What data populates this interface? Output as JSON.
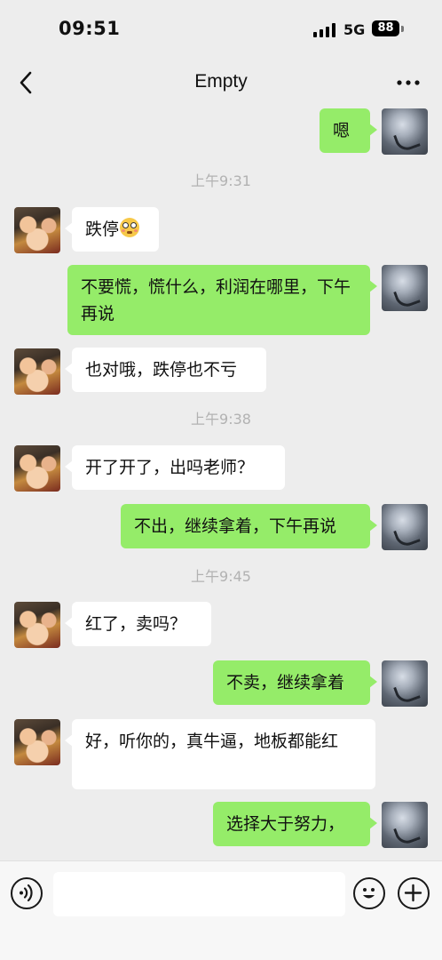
{
  "status_bar": {
    "time": "09:51",
    "network": "5G",
    "battery": "88"
  },
  "header": {
    "title": "Empty"
  },
  "messages": [
    {
      "sender": "self",
      "text": "嗯"
    },
    {
      "type": "time",
      "text": "上午9:31"
    },
    {
      "sender": "other",
      "text": "跌停"
    },
    {
      "sender": "self",
      "text": "不要慌，慌什么，利润在哪里，下午再说"
    },
    {
      "sender": "other",
      "text": "也对哦，跌停也不亏"
    },
    {
      "type": "time",
      "text": "上午9:38"
    },
    {
      "sender": "other",
      "text": "开了开了，出吗老师？"
    },
    {
      "sender": "self",
      "text": "不出，继续拿着，下午再说"
    },
    {
      "type": "time",
      "text": "上午9:45"
    },
    {
      "sender": "other",
      "text": "红了，卖吗？"
    },
    {
      "sender": "self",
      "text": "不卖，继续拿着"
    },
    {
      "sender": "other",
      "text": "好，听你的，真牛逼，地板都能红"
    },
    {
      "sender": "self",
      "text": "选择大于努力，"
    }
  ],
  "icons": {
    "back": "chevron-left-icon",
    "more": "more-icon",
    "voice": "voice-icon",
    "emoji": "emoji-icon",
    "plus": "plus-icon",
    "emoji_in_message": "flushed-face-emoji"
  },
  "colors": {
    "self_bubble": "#95ec69",
    "other_bubble": "#ffffff",
    "background": "#ededed",
    "timestamp": "#b2b2b2"
  }
}
